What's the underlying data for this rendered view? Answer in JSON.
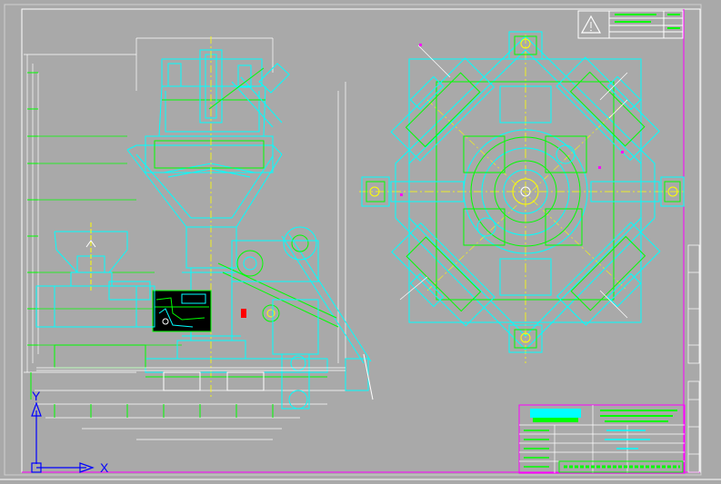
{
  "axes": {
    "y_label": "Y",
    "x_label": "X"
  },
  "colors": {
    "background": "#a9a9a9",
    "primary_lines": "#00ffff",
    "secondary_lines": "#00ff00",
    "center_lines": "#ffff00",
    "dimensions": "#ffffff",
    "accents": "#ff00ff",
    "black_fill": "#000000",
    "ucs_icon": "#0000ff"
  },
  "icons": {
    "ucs": "ucs-axis-icon",
    "warning": "warning-triangle-icon"
  }
}
